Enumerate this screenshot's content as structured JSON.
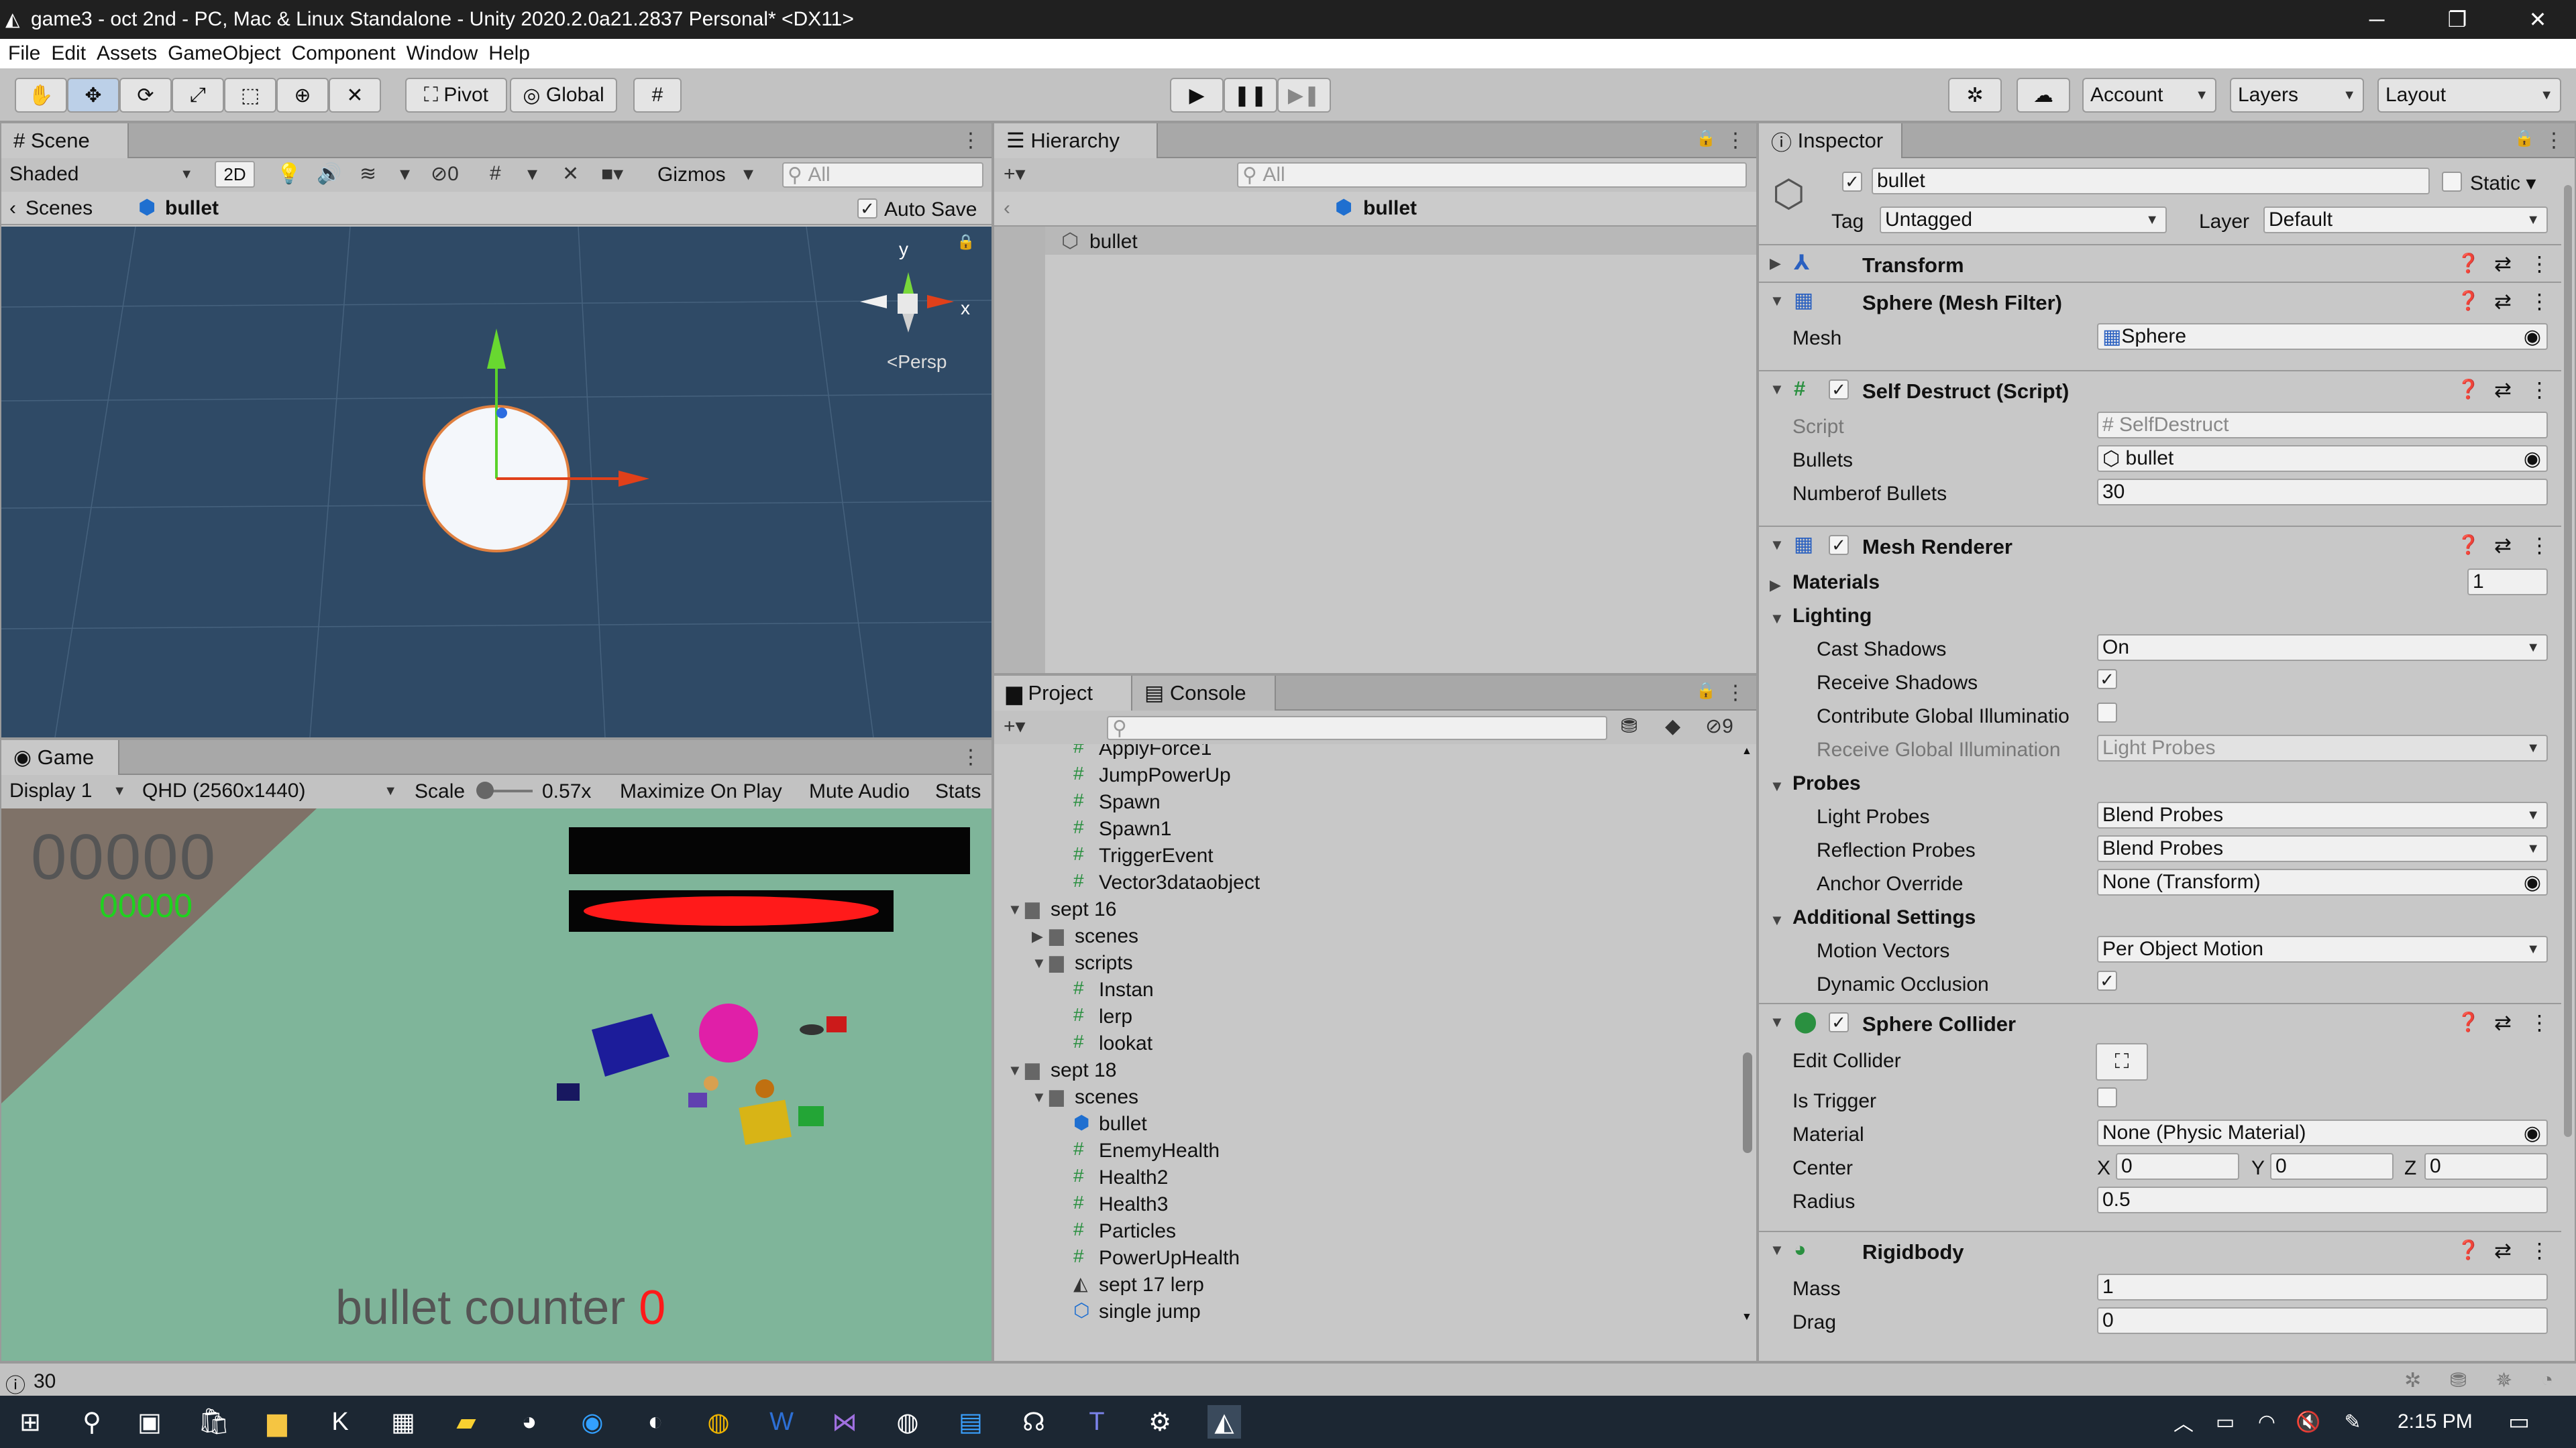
{
  "window": {
    "title": "game3 - oct 2nd - PC, Mac & Linux Standalone - Unity 2020.2.0a21.2837 Personal* <DX11>"
  },
  "menu": [
    "File",
    "Edit",
    "Assets",
    "GameObject",
    "Component",
    "Window",
    "Help"
  ],
  "toolbar": {
    "pivot": "Pivot",
    "global": "Global",
    "account": "Account",
    "layers": "Layers",
    "layout": "Layout"
  },
  "scene": {
    "tab": "Scene",
    "shading": "Shaded",
    "mode2d": "2D",
    "gizmos": "Gizmos",
    "search_placeholder": "All",
    "hidden_count": "0",
    "breadcrumb_scenes": "Scenes",
    "breadcrumb_obj": "bullet",
    "autosave": "Auto Save",
    "gizmo_y": "y",
    "gizmo_x": "x",
    "persp": "Persp"
  },
  "game": {
    "tab": "Game",
    "display": "Display 1",
    "resolution": "QHD (2560x1440)",
    "scale_label": "Scale",
    "scale_value": "0.57x",
    "maximize": "Maximize On Play",
    "mute": "Mute Audio",
    "stats": "Stats",
    "score_big": "00000",
    "score_small": "00000",
    "bullet_counter_label": "bullet counter",
    "bullet_counter_value": "0"
  },
  "hierarchy": {
    "tab": "Hierarchy",
    "search_placeholder": "All",
    "scene_name": "bullet",
    "items": [
      "bullet"
    ]
  },
  "project": {
    "tab": "Project",
    "console_tab": "Console",
    "hidden_count": "9",
    "items": [
      {
        "label": "ApplyForce1",
        "type": "script",
        "indent": 3
      },
      {
        "label": "JumpPowerUp",
        "type": "script",
        "indent": 3
      },
      {
        "label": "Spawn",
        "type": "script",
        "indent": 3
      },
      {
        "label": "Spawn1",
        "type": "script",
        "indent": 3
      },
      {
        "label": "TriggerEvent",
        "type": "script",
        "indent": 3
      },
      {
        "label": "Vector3dataobject",
        "type": "script",
        "indent": 3
      },
      {
        "label": "sept 16",
        "type": "folder-open",
        "indent": 1
      },
      {
        "label": "scenes",
        "type": "folder-closed",
        "indent": 2
      },
      {
        "label": "scripts",
        "type": "folder-open",
        "indent": 2
      },
      {
        "label": "Instan",
        "type": "script",
        "indent": 3
      },
      {
        "label": "lerp",
        "type": "script",
        "indent": 3
      },
      {
        "label": "lookat",
        "type": "script",
        "indent": 3
      },
      {
        "label": "sept 18",
        "type": "folder-open",
        "indent": 1
      },
      {
        "label": "scenes",
        "type": "folder-open",
        "indent": 2
      },
      {
        "label": "bullet",
        "type": "prefab",
        "indent": 3
      },
      {
        "label": "EnemyHealth",
        "type": "script",
        "indent": 3
      },
      {
        "label": "Health2",
        "type": "script",
        "indent": 3
      },
      {
        "label": "Health3",
        "type": "script",
        "indent": 3
      },
      {
        "label": "Particles",
        "type": "script",
        "indent": 3
      },
      {
        "label": "PowerUpHealth",
        "type": "script",
        "indent": 3
      },
      {
        "label": "sept 17 lerp",
        "type": "unity",
        "indent": 3
      },
      {
        "label": "single jump",
        "type": "prefab-variant",
        "indent": 3
      }
    ]
  },
  "inspector": {
    "tab": "Inspector",
    "name": "bullet",
    "static": "Static",
    "tag_label": "Tag",
    "tag": "Untagged",
    "layer_label": "Layer",
    "layer": "Default",
    "transform": "Transform",
    "meshfilter": {
      "title": "Sphere (Mesh Filter)",
      "mesh_label": "Mesh",
      "mesh": "Sphere"
    },
    "selfdestruct": {
      "title": "Self Destruct (Script)",
      "script_label": "Script",
      "script": "SelfDestruct",
      "bullets_label": "Bullets",
      "bullets": "bullet",
      "num_label": "Numberof Bullets",
      "num": "30"
    },
    "meshrenderer": {
      "title": "Mesh Renderer",
      "materials": "Materials",
      "materials_count": "1",
      "lighting": "Lighting",
      "cast_shadows_label": "Cast Shadows",
      "cast_shadows": "On",
      "receive_shadows": "Receive Shadows",
      "contribute_gi": "Contribute Global Illuminatio",
      "receive_gi_label": "Receive Global Illumination",
      "receive_gi": "Light Probes",
      "probes": "Probes",
      "light_probes_label": "Light Probes",
      "light_probes": "Blend Probes",
      "reflection_probes_label": "Reflection Probes",
      "reflection_probes": "Blend Probes",
      "anchor_label": "Anchor Override",
      "anchor": "None (Transform)",
      "additional": "Additional Settings",
      "motion_label": "Motion Vectors",
      "motion": "Per Object Motion",
      "dynamic_occ": "Dynamic Occlusion"
    },
    "spherecollider": {
      "title": "Sphere Collider",
      "edit_label": "Edit Collider",
      "trigger_label": "Is Trigger",
      "material_label": "Material",
      "material": "None (Physic Material)",
      "center_label": "Center",
      "cx_label": "X",
      "cx": "0",
      "cy_label": "Y",
      "cy": "0",
      "cz_label": "Z",
      "cz": "0",
      "radius_label": "Radius",
      "radius": "0.5"
    },
    "rigidbody": {
      "title": "Rigidbody",
      "mass_label": "Mass",
      "mass": "1",
      "drag_label": "Drag",
      "drag": "0"
    }
  },
  "status": {
    "count": "30"
  },
  "taskbar": {
    "time": "2:15 PM"
  }
}
